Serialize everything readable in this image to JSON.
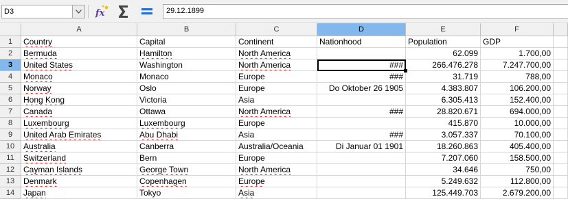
{
  "formula_bar": {
    "name_box": "D3",
    "formula": "29.12.1899",
    "icons": [
      "chevron-down-icon",
      "function-wizard-icon",
      "sum-icon",
      "equals-icon"
    ]
  },
  "sheet": {
    "selected_cell": "D3",
    "columns": [
      "A",
      "B",
      "C",
      "D",
      "E",
      "F"
    ],
    "rows": [
      {
        "num": "1",
        "cells": [
          "Country",
          "Capital",
          "Continent",
          "Nationhood",
          "Population",
          "GDP"
        ]
      },
      {
        "num": "2",
        "cells": [
          "Bermuda",
          "Hamilton",
          "North America",
          "",
          "62.099",
          "1.700,00"
        ]
      },
      {
        "num": "3",
        "cells": [
          "United States",
          "Washington",
          "North America",
          "###",
          "266.476.278",
          "7.247.700,00"
        ]
      },
      {
        "num": "4",
        "cells": [
          "Monaco",
          "Monaco",
          "Europe",
          "###",
          "31.719",
          "788,00"
        ]
      },
      {
        "num": "5",
        "cells": [
          "Norway",
          "Oslo",
          "Europe",
          "Do Oktober 26 1905",
          "4.383.807",
          "106.200,00"
        ]
      },
      {
        "num": "6",
        "cells": [
          "Hong Kong",
          "Victoria",
          "Asia",
          "",
          "6.305.413",
          "152.400,00"
        ]
      },
      {
        "num": "7",
        "cells": [
          "Canada",
          "Ottawa",
          "North America",
          "###",
          "28.820.671",
          "694.000,00"
        ]
      },
      {
        "num": "8",
        "cells": [
          "Luxembourg",
          "Luxembourg",
          "Europe",
          "",
          "415.870",
          "10.000,00"
        ]
      },
      {
        "num": "9",
        "cells": [
          "United Arab Emirates",
          "Abu Dhabi",
          "Asia",
          "###",
          "3.057.337",
          "70.100,00"
        ]
      },
      {
        "num": "10",
        "cells": [
          "Australia",
          "Canberra",
          "Australia/Oceania",
          "Di Januar 01 1901",
          "18.260.863",
          "405.400,00"
        ]
      },
      {
        "num": "11",
        "cells": [
          "Switzerland",
          "Bern",
          "Europe",
          "",
          "7.207.060",
          "158.500,00"
        ]
      },
      {
        "num": "12",
        "cells": [
          "Cayman Islands",
          "George Town",
          "North America",
          "",
          "34.646",
          "750,00"
        ]
      },
      {
        "num": "13",
        "cells": [
          "Denmark",
          "Copenhagen",
          "Europe",
          "",
          "5.249.632",
          "112.800,00"
        ]
      },
      {
        "num": "14",
        "cells": [
          "Japan",
          "Tokyo",
          "Asia",
          "",
          "125.449.703",
          "2.679.200,00"
        ]
      }
    ]
  }
}
